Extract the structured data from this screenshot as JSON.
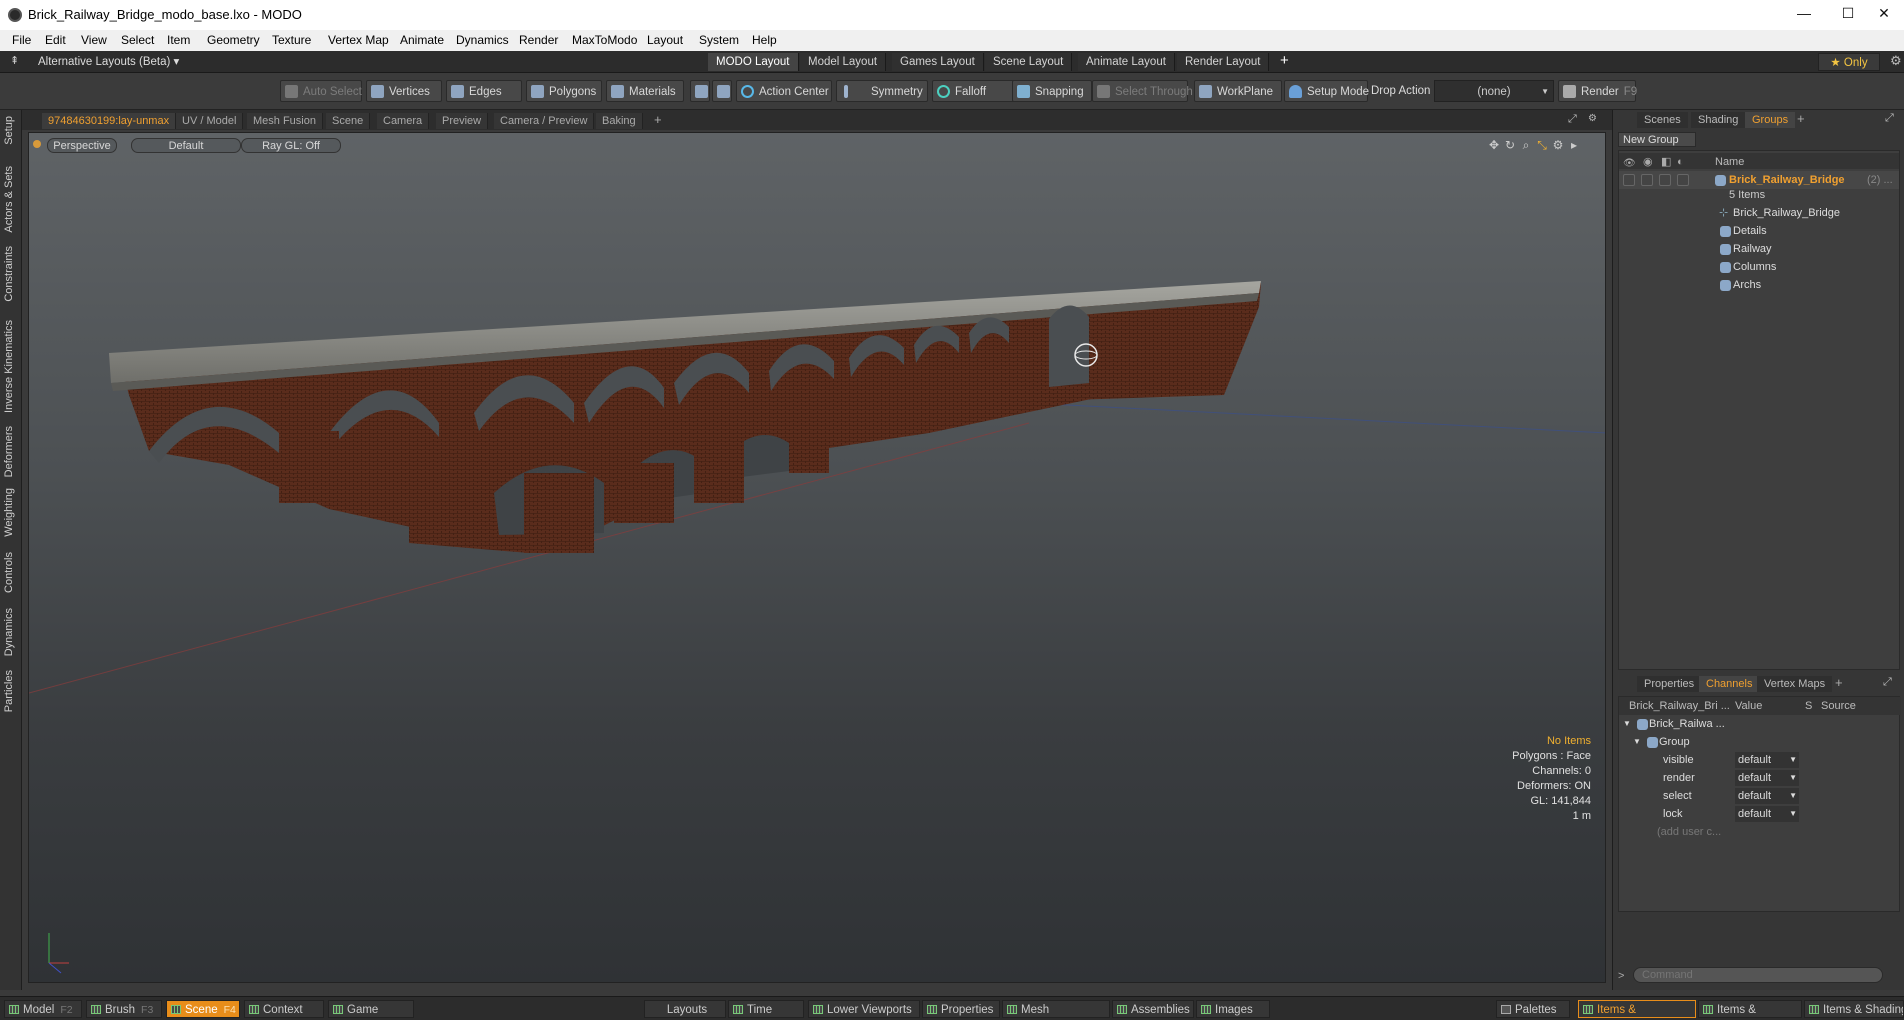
{
  "window": {
    "title": "Brick_Railway_Bridge_modo_base.lxo - MODO",
    "minimize": "—",
    "maximize": "☐",
    "close": "✕"
  },
  "menu": [
    "File",
    "Edit",
    "View",
    "Select",
    "Item",
    "Geometry",
    "Texture",
    "Vertex Map",
    "Animate",
    "Dynamics",
    "Render",
    "MaxToModo",
    "Layout",
    "System",
    "Help"
  ],
  "layoutbar": {
    "alt_layouts": "Alternative Layouts (Beta) ▾",
    "tabs": [
      "MODO Layout",
      "Model Layout",
      "Games Layout",
      "Scene Layout",
      "Animate Layout",
      "Render Layout"
    ],
    "add": "+",
    "only": "★  Only"
  },
  "toolbar": {
    "auto_select": "Auto Select",
    "vertices": "Vertices",
    "edges": "Edges",
    "polygons": "Polygons",
    "materials": "Materials",
    "action_center": "Action Center",
    "symmetry": "Symmetry",
    "falloff": "Falloff",
    "snapping": "Snapping",
    "select_through": "Select Through",
    "workplane": "WorkPlane",
    "setup_mode": "Setup Mode",
    "drop_action": "Drop Action",
    "drop_value": "(none)",
    "render": "Render",
    "render_key": "F9"
  },
  "left_tabs": [
    "Setup",
    "Actors & Sets",
    "Constraints",
    "Inverse Kinematics",
    "Deformers",
    "Weighting",
    "Controls",
    "Dynamics",
    "Particles"
  ],
  "viewport_tabs": {
    "items": [
      "97484630199:lay-unmax",
      "UV / Model",
      "Mesh Fusion",
      "Scene",
      "Camera",
      "Preview",
      "Camera / Preview",
      "Baking"
    ],
    "add": "+"
  },
  "viewport": {
    "view": "Perspective",
    "shading": "Default",
    "raygl": "Ray GL: Off",
    "stats": {
      "items": "No Items",
      "polygons": "Polygons : Face",
      "channels": "Channels: 0",
      "deformers": "Deformers: ON",
      "gl": "GL: 141,844",
      "scale": "1 m"
    }
  },
  "right_panel": {
    "top_tabs": [
      "Scenes",
      "Shading",
      "Groups"
    ],
    "add": "+",
    "new_group": "New Group",
    "name_header": "Name",
    "group": {
      "name": "Brick_Railway_Bridge",
      "count_suffix": "(2) ...",
      "items_label": "5 Items",
      "children": [
        "Brick_Railway_Bridge",
        "Details",
        "Railway",
        "Columns",
        "Archs"
      ]
    },
    "bottom_tabs": [
      "Properties",
      "Channels",
      "Vertex Maps"
    ],
    "channels": {
      "headers": [
        "Brick_Railway_Bri ...",
        "Value",
        "S",
        "Source"
      ],
      "root": "Brick_Railwa ...",
      "sub": "Group",
      "rows": [
        {
          "name": "visible",
          "value": "default"
        },
        {
          "name": "render",
          "value": "default"
        },
        {
          "name": "select",
          "value": "default"
        },
        {
          "name": "lock",
          "value": "default"
        }
      ],
      "add_user": "(add user c..."
    },
    "command_placeholder": "Command"
  },
  "bottombar": {
    "left": [
      {
        "label": "Model",
        "key": "F2"
      },
      {
        "label": "Brush",
        "key": "F3"
      },
      {
        "label": "Scene",
        "key": "F4"
      },
      {
        "label": "Context",
        "key": ""
      },
      {
        "label": "Game Tools",
        "key": ""
      }
    ],
    "center": [
      "Layouts",
      "Time",
      "Lower Viewports",
      "Properties",
      "Mesh Operations",
      "Assemblies",
      "Images"
    ],
    "right": [
      "Palettes",
      "Items & Properties",
      "Items & Groups",
      "Items & Shading"
    ]
  }
}
